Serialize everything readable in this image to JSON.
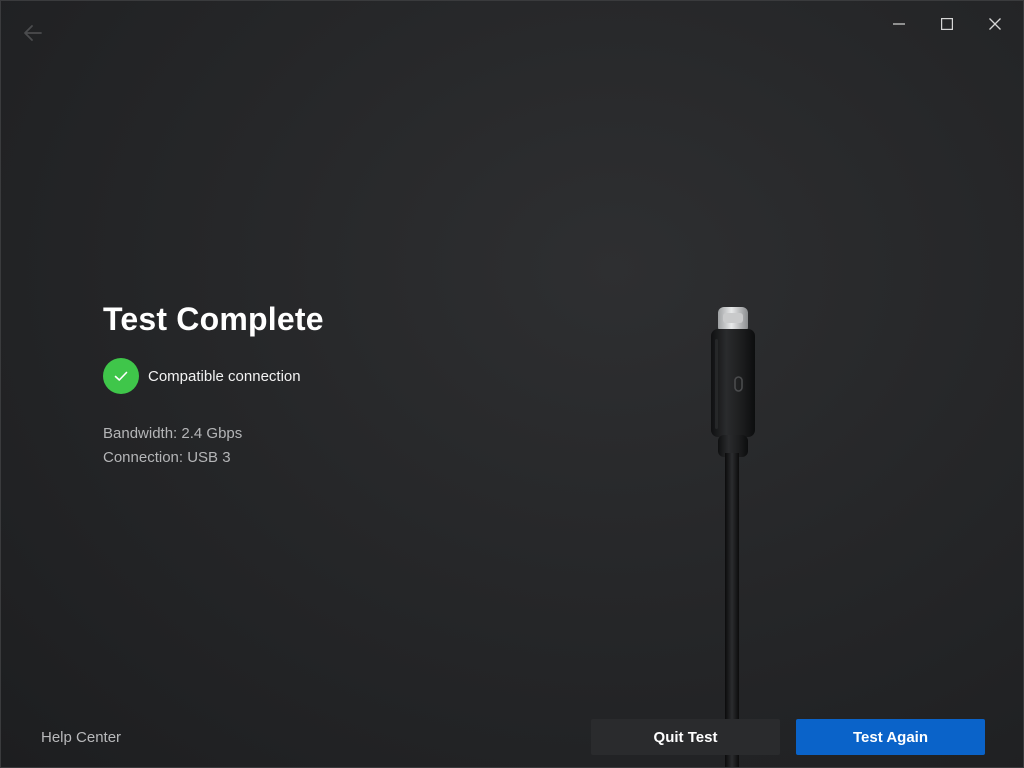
{
  "window": {
    "controls": {
      "minimize_icon": "minimize-icon",
      "maximize_icon": "maximize-icon",
      "close_icon": "close-icon"
    },
    "back_icon": "arrow-left-icon"
  },
  "main": {
    "title": "Test Complete",
    "status": {
      "icon": "checkmark-icon",
      "text": "Compatible connection",
      "color": "#3fc64a"
    },
    "details": {
      "bandwidth": "Bandwidth: 2.4 Gbps",
      "connection": "Connection: USB 3"
    }
  },
  "footer": {
    "help_label": "Help Center",
    "quit_label": "Quit Test",
    "again_label": "Test Again",
    "accent_color": "#0a63c9"
  }
}
